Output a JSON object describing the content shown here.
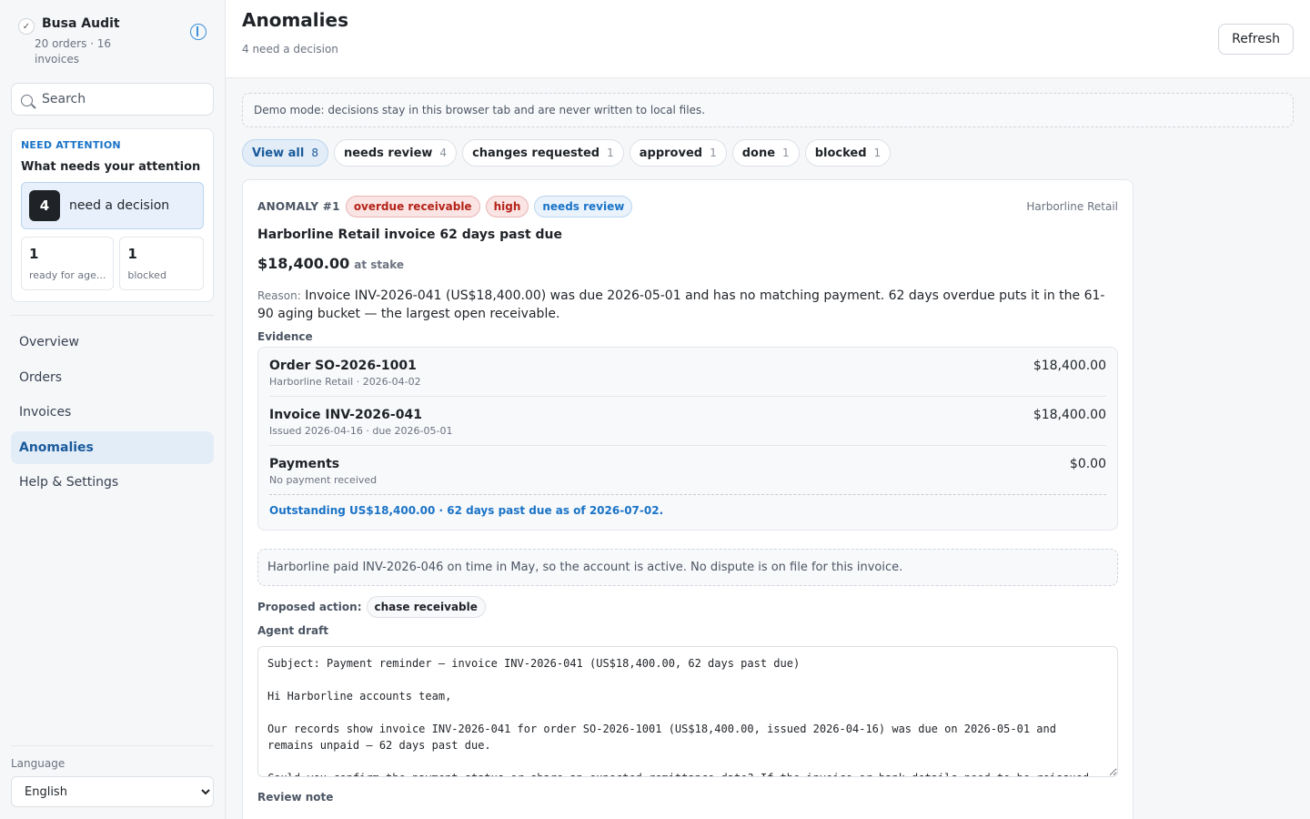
{
  "sidebar": {
    "brand_title": "Busa Audit",
    "brand_sub": "20 orders · 16 invoices",
    "search_placeholder": "Search",
    "attention": {
      "eyebrow": "NEED ATTENTION",
      "title": "What needs your attention",
      "decision_count": "4",
      "decision_label": "need a decision",
      "ready_count": "1",
      "ready_label": "ready for age...",
      "blocked_count": "1",
      "blocked_label": "blocked"
    },
    "nav": [
      "Overview",
      "Orders",
      "Invoices",
      "Anomalies",
      "Help & Settings"
    ],
    "active_nav": "Anomalies",
    "language_label": "Language",
    "language_value": "English"
  },
  "header": {
    "title": "Anomalies",
    "subtitle": "4 need a decision",
    "refresh_label": "Refresh"
  },
  "demo_note": "Demo mode: decisions stay in this browser tab and are never written to local files.",
  "filters": [
    {
      "label": "View all",
      "count": "8"
    },
    {
      "label": "needs review",
      "count": "4"
    },
    {
      "label": "changes requested",
      "count": "1"
    },
    {
      "label": "approved",
      "count": "1"
    },
    {
      "label": "done",
      "count": "1"
    },
    {
      "label": "blocked",
      "count": "1"
    }
  ],
  "anomaly": {
    "id_label": "ANOMALY #1",
    "tags": {
      "type": "overdue receivable",
      "severity": "high",
      "status": "needs review"
    },
    "customer": "Harborline Retail",
    "title": "Harborline Retail invoice 62 days past due",
    "amount": "$18,400.00",
    "amount_suffix": "at stake",
    "reason_label": "Reason:",
    "reason_text": "Invoice INV-2026-041 (US$18,400.00) was due 2026-05-01 and has no matching payment. 62 days overdue puts it in the 61-90 aging bucket — the largest open receivable.",
    "evidence_label": "Evidence",
    "evidence": [
      {
        "name": "Order SO-2026-1001",
        "meta": "Harborline Retail · 2026-04-02",
        "amount": "$18,400.00"
      },
      {
        "name": "Invoice INV-2026-041",
        "meta": "Issued 2026-04-16 · due 2026-05-01",
        "amount": "$18,400.00"
      },
      {
        "name": "Payments",
        "meta": "No payment received",
        "amount": "$0.00"
      }
    ],
    "outstanding": "Outstanding US$18,400.00 · 62 days past due as of 2026-07-02.",
    "context_note": "Harborline paid INV-2026-046 on time in May, so the account is active. No dispute is on file for this invoice.",
    "proposed_label": "Proposed action:",
    "proposed_action": "chase receivable",
    "draft_label": "Agent draft",
    "draft_text": "Subject: Payment reminder — invoice INV-2026-041 (US$18,400.00, 62 days past due)\n\nHi Harborline accounts team,\n\nOur records show invoice INV-2026-041 for order SO-2026-1001 (US$18,400.00, issued 2026-04-16) was due on 2026-05-01 and remains unpaid — 62 days past due.\n\nCould you confirm the payment status or share an expected remittance date? If the invoice or bank details need to be reissued",
    "review_label": "Review note"
  }
}
